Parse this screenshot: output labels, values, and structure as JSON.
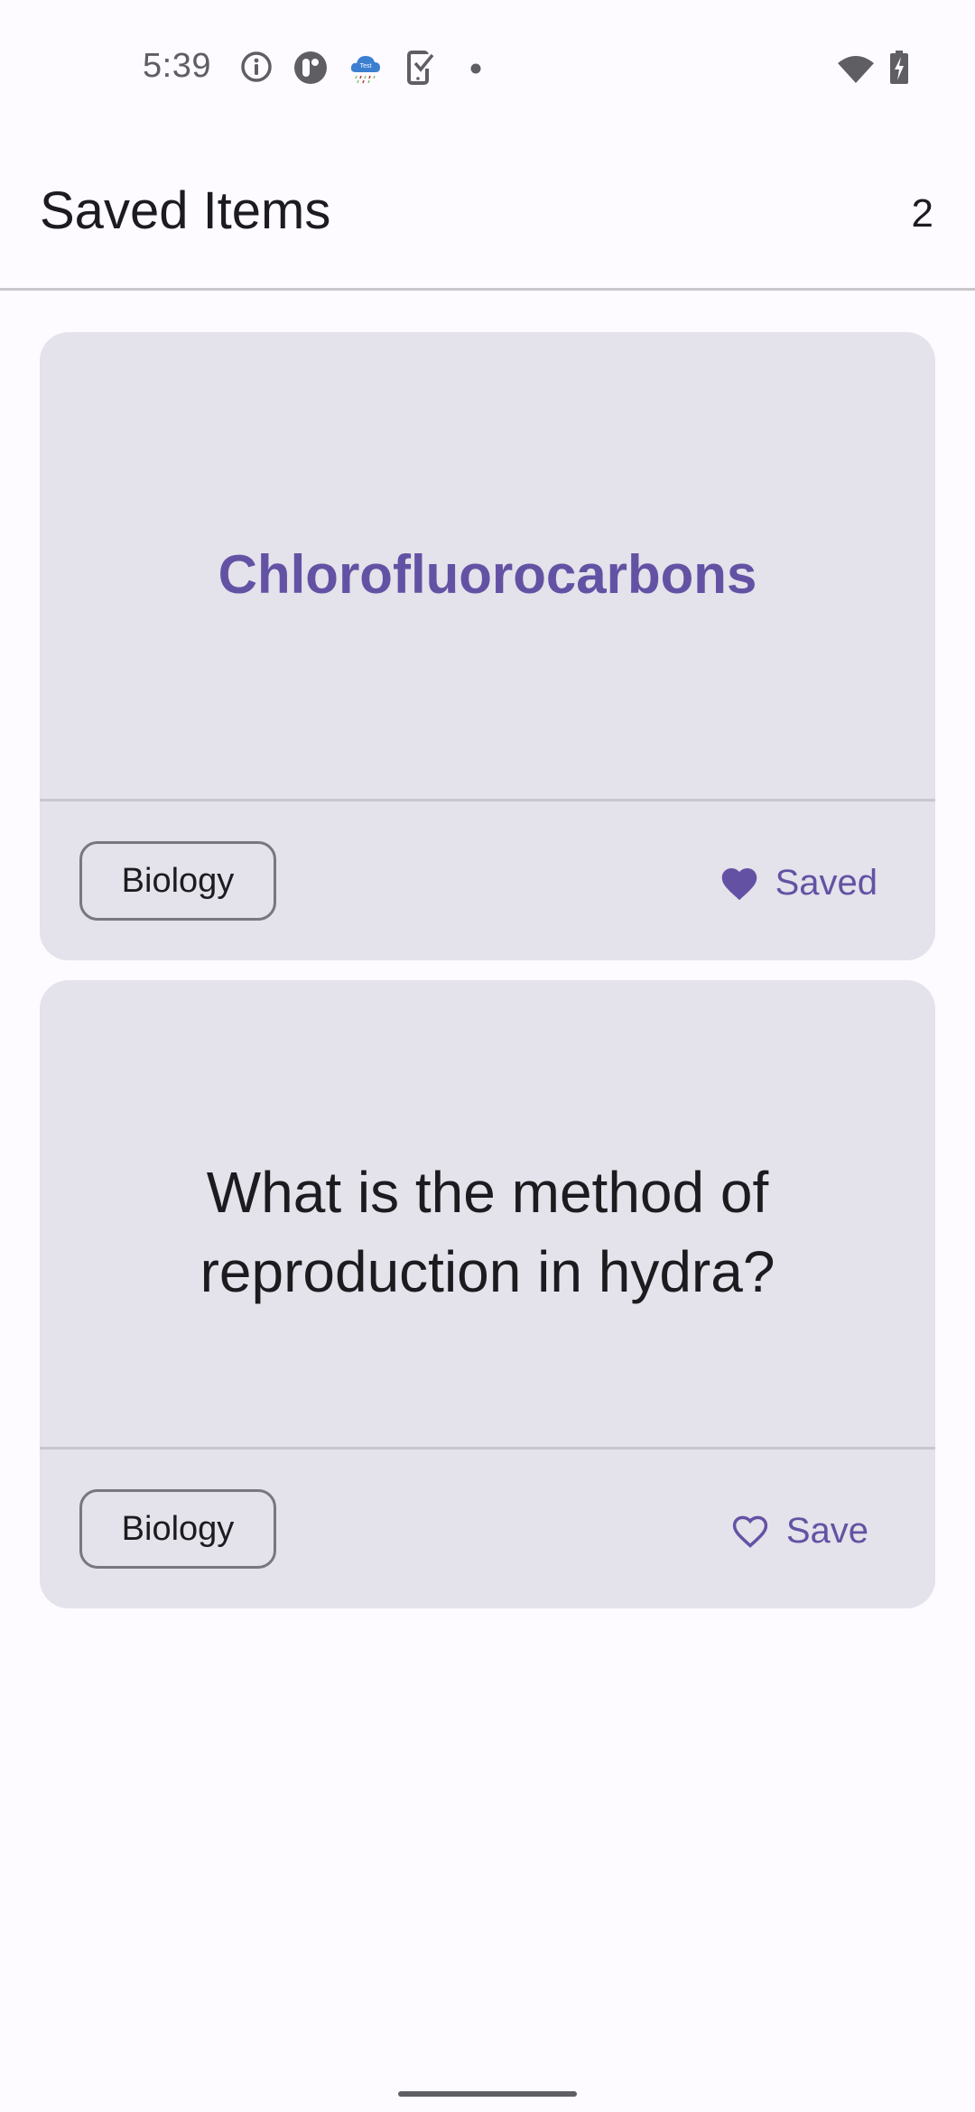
{
  "status_bar": {
    "time": "5:39",
    "left_icons": [
      "info-icon",
      "app-r-icon",
      "test-cloud-icon",
      "device-check-icon",
      "notification-dot-icon"
    ],
    "right_icons": [
      "wifi-icon",
      "battery-charging-icon"
    ]
  },
  "app_bar": {
    "title": "Saved Items",
    "count": "2"
  },
  "colors": {
    "accent": "#6352a4",
    "card_background": "#e4e2ea",
    "page_background": "#fdfbff",
    "text_primary": "#1c1b1f",
    "divider": "#c9c7cc"
  },
  "cards": [
    {
      "text": "Chlorofluorocarbons",
      "style": "term",
      "category": "Biology",
      "save_label": "Saved",
      "saved": true,
      "icon": "heart-filled-icon"
    },
    {
      "text": "What is the method of reproduction in hydra?",
      "style": "question",
      "category": "Biology",
      "save_label": "Save",
      "saved": false,
      "icon": "heart-outline-icon"
    }
  ]
}
